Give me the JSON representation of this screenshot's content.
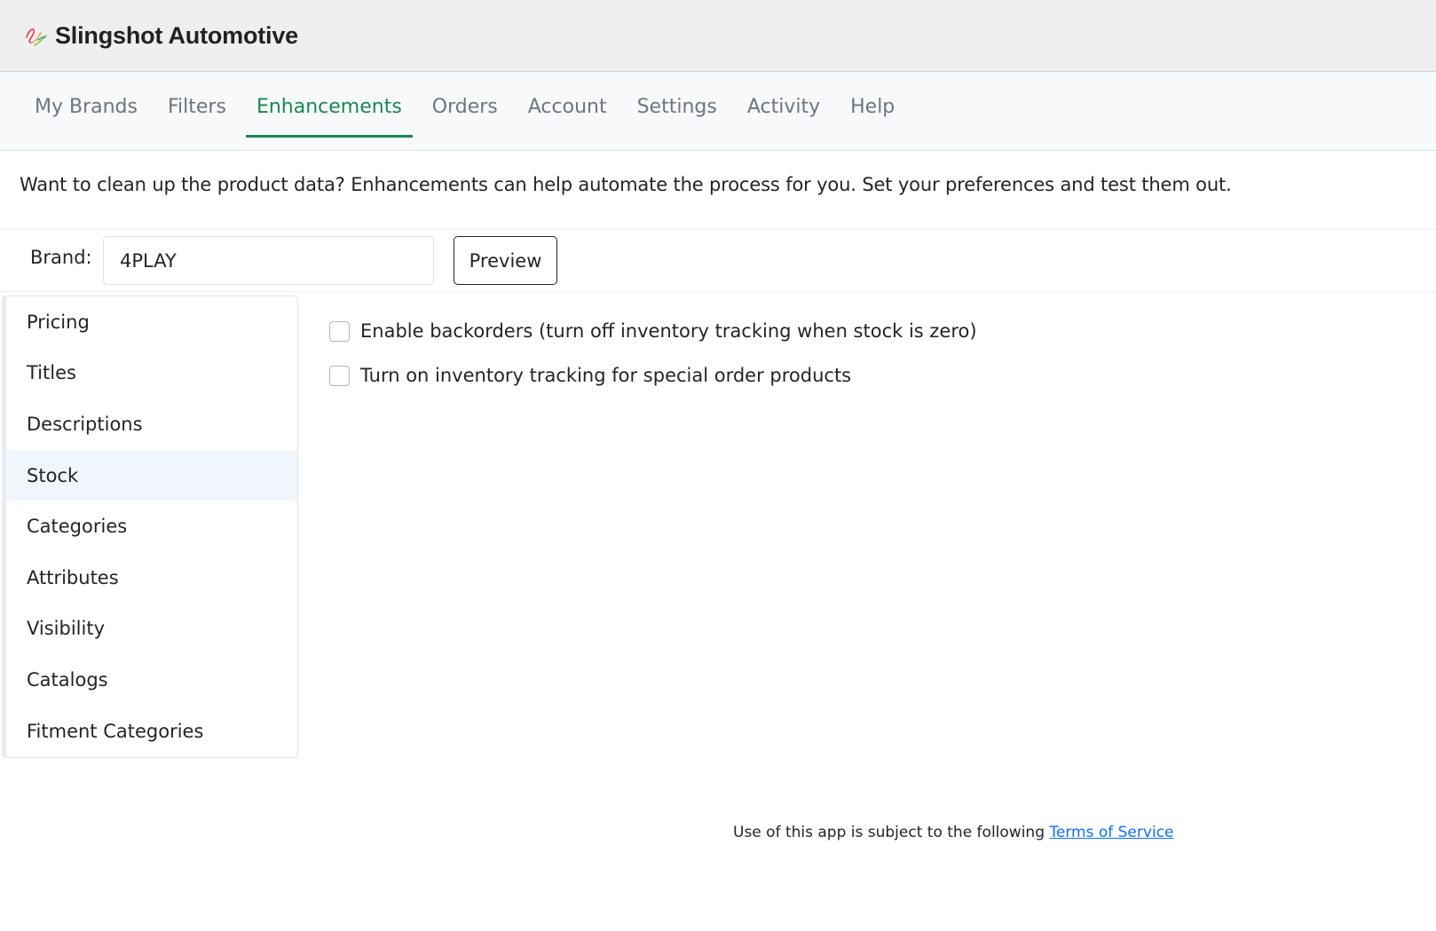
{
  "header": {
    "title": "Slingshot Automotive",
    "logo_icon": "slingshot-logo-icon",
    "logo_colors": [
      "#e63946",
      "#2a9d8f",
      "#f4a261",
      "#8ac926"
    ]
  },
  "nav": {
    "tabs": [
      {
        "label": "My Brands",
        "active": false
      },
      {
        "label": "Filters",
        "active": false
      },
      {
        "label": "Enhancements",
        "active": true
      },
      {
        "label": "Orders",
        "active": false
      },
      {
        "label": "Account",
        "active": false
      },
      {
        "label": "Settings",
        "active": false
      },
      {
        "label": "Activity",
        "active": false
      },
      {
        "label": "Help",
        "active": false
      }
    ],
    "active_color": "#198754"
  },
  "intro_text": "Want to clean up the product data? Enhancements can help automate the process for you. Set your preferences and test them out.",
  "brand": {
    "label": "Brand:",
    "value": "4PLAY",
    "preview_label": "Preview"
  },
  "side_menu": {
    "items": [
      {
        "label": "Pricing",
        "active": false
      },
      {
        "label": "Titles",
        "active": false
      },
      {
        "label": "Descriptions",
        "active": false
      },
      {
        "label": "Stock",
        "active": true
      },
      {
        "label": "Categories",
        "active": false
      },
      {
        "label": "Attributes",
        "active": false
      },
      {
        "label": "Visibility",
        "active": false
      },
      {
        "label": "Catalogs",
        "active": false
      },
      {
        "label": "Fitment Categories",
        "active": false
      }
    ],
    "active_color": "#0d6efd"
  },
  "stock_options": [
    {
      "label": "Enable backorders (turn off inventory tracking when stock is zero)",
      "checked": false
    },
    {
      "label": "Turn on inventory tracking for special order products",
      "checked": false
    }
  ],
  "footer": {
    "text": "Use of this app is subject to the following",
    "link_label": "Terms of Service"
  }
}
